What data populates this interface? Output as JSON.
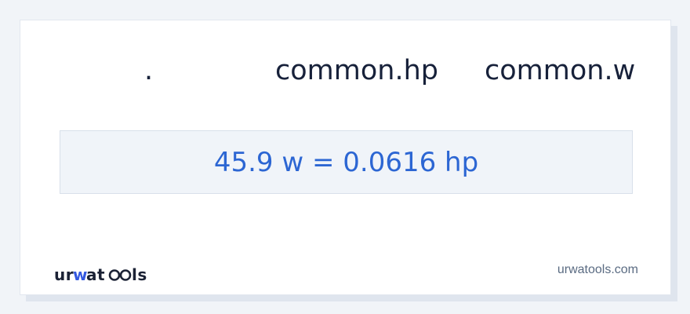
{
  "header": {
    "col_key": ".",
    "col_hp": "common.hp",
    "col_w": "common.w"
  },
  "result": {
    "text": "45.9 w = 0.0616 hp"
  },
  "footer": {
    "logo_text": "urwatools",
    "site": "urwatools.com"
  },
  "colors": {
    "result_text": "#2c66d3",
    "header_text": "#17213a",
    "logo_accent": "#3358e0"
  }
}
